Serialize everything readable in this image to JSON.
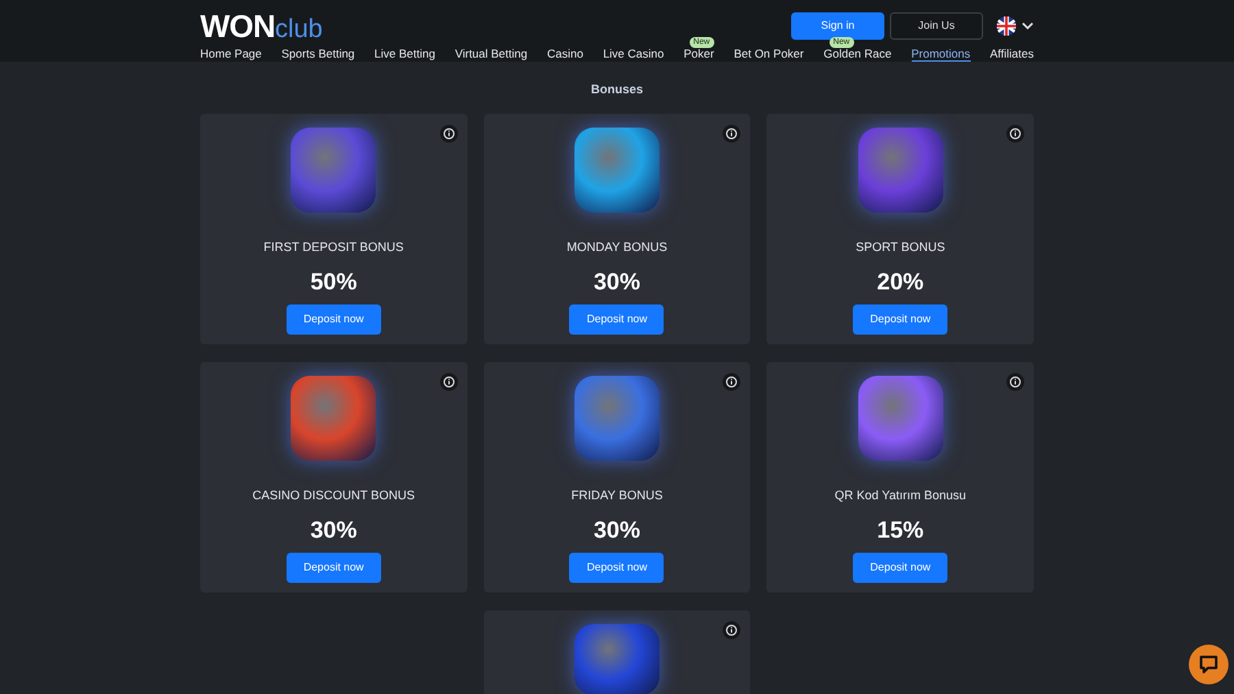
{
  "header": {
    "logo": {
      "bold": "WON",
      "light": "club"
    },
    "buttons": [
      {
        "label": "Sign in",
        "kind": "primary"
      },
      {
        "label": "Join Us",
        "kind": "outline"
      }
    ]
  },
  "nav": [
    {
      "label": "Home Page",
      "selected": false
    },
    {
      "label": "Sports Betting",
      "selected": false
    },
    {
      "label": "Live Betting",
      "selected": false
    },
    {
      "label": "Virtual Betting",
      "selected": false
    },
    {
      "label": "Casino",
      "selected": false
    },
    {
      "label": "Live Casino",
      "selected": false
    },
    {
      "label": "Poker",
      "selected": false,
      "badge": "New"
    },
    {
      "label": "Bet On Poker",
      "selected": false
    },
    {
      "label": "Golden Race",
      "selected": false,
      "badge": "New"
    },
    {
      "label": "Promotions",
      "selected": true
    },
    {
      "label": "Affiliates",
      "selected": false
    }
  ],
  "page_title": "Bonuses",
  "bonuses": [
    {
      "title": "FIRST DEPOSIT BONUS",
      "percent": "50%",
      "button": "Deposit now",
      "color": "#5b4bd6"
    },
    {
      "title": "MONDAY BONUS",
      "percent": "30%",
      "button": "Deposit now",
      "color": "#1fa3e6"
    },
    {
      "title": "SPORT BONUS",
      "percent": "20%",
      "button": "Deposit now",
      "color": "#6b3fd9"
    },
    {
      "title": "CASINO DISCOUNT BONUS",
      "percent": "30%",
      "button": "Deposit now",
      "color": "#d9452b"
    },
    {
      "title": "FRIDAY BONUS",
      "percent": "30%",
      "button": "Deposit now",
      "color": "#3a6fe0"
    },
    {
      "title": "QR Kod Yatırım Bonusu",
      "percent": "15%",
      "button": "Deposit now",
      "color": "#8b5cf6"
    },
    {
      "color": "#2346d6"
    }
  ]
}
